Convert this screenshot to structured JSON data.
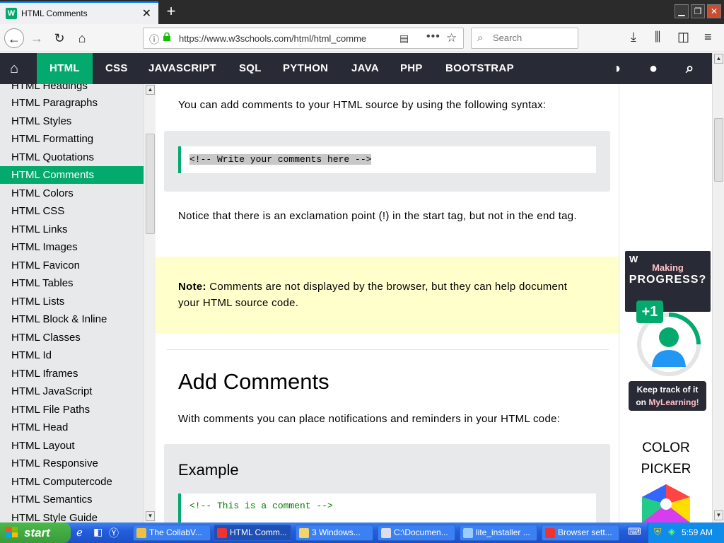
{
  "browser": {
    "tab_title": "HTML Comments",
    "tab_close": "✕",
    "new_tab": "+",
    "favicon": "W",
    "url": "https://www.w3schools.com/html/html_comme",
    "search_placeholder": "Search",
    "icons": [
      "back-icon",
      "forward-icon",
      "reload-icon",
      "home-icon",
      "info-icon",
      "lock-icon",
      "reader-icon",
      "more-icon",
      "bookmark-star-icon",
      "search-icon",
      "download-icon",
      "library-icon",
      "sidebar-icon",
      "menu-icon"
    ]
  },
  "w3nav": {
    "items": [
      "HTML",
      "CSS",
      "JAVASCRIPT",
      "SQL",
      "PYTHON",
      "JAVA",
      "PHP",
      "BOOTSTRAP"
    ],
    "icons": [
      "home-icon",
      "contrast-icon",
      "globe-icon",
      "search-icon"
    ],
    "accent": "#04aa6d",
    "bg": "#282a35"
  },
  "sidebar": {
    "active": "HTML Comments",
    "items": [
      "HTML Headings",
      "HTML Paragraphs",
      "HTML Styles",
      "HTML Formatting",
      "HTML Quotations",
      "HTML Comments",
      "HTML Colors",
      "HTML CSS",
      "HTML Links",
      "HTML Images",
      "HTML Favicon",
      "HTML Tables",
      "HTML Lists",
      "HTML Block & Inline",
      "HTML Classes",
      "HTML Id",
      "HTML Iframes",
      "HTML JavaScript",
      "HTML File Paths",
      "HTML Head",
      "HTML Layout",
      "HTML Responsive",
      "HTML Computercode",
      "HTML Semantics",
      "HTML Style Guide"
    ]
  },
  "main": {
    "intro": "You can add comments to your HTML source by using the following syntax:",
    "syntax_code": "<!-- Write your comments here -->",
    "notice": "Notice that there is an exclamation point (!) in the start tag, but not in the end tag.",
    "note_label": "Note:",
    "note_text": " Comments are not displayed by the browser, but they can help document your HTML source code.",
    "heading": "Add Comments",
    "paragraph": "With comments you can place notifications and reminders in your HTML code:",
    "example_title": "Example",
    "example_code": "<!-- This is a comment -->"
  },
  "ad": {
    "logo": "W",
    "making": "Making",
    "progress": "PROGRESS?",
    "plus": "+1",
    "keep": "Keep track of it",
    "on": "on ",
    "mylearning": "MyLearning!",
    "color_picker": "COLOR PICKER"
  },
  "taskbar": {
    "start": "start",
    "tasks": [
      "The CollabV...",
      "HTML Comm...",
      "3 Windows...",
      "C:\\Documen...",
      "lite_installer ...",
      "Browser sett..."
    ],
    "time": "5:59 AM"
  }
}
